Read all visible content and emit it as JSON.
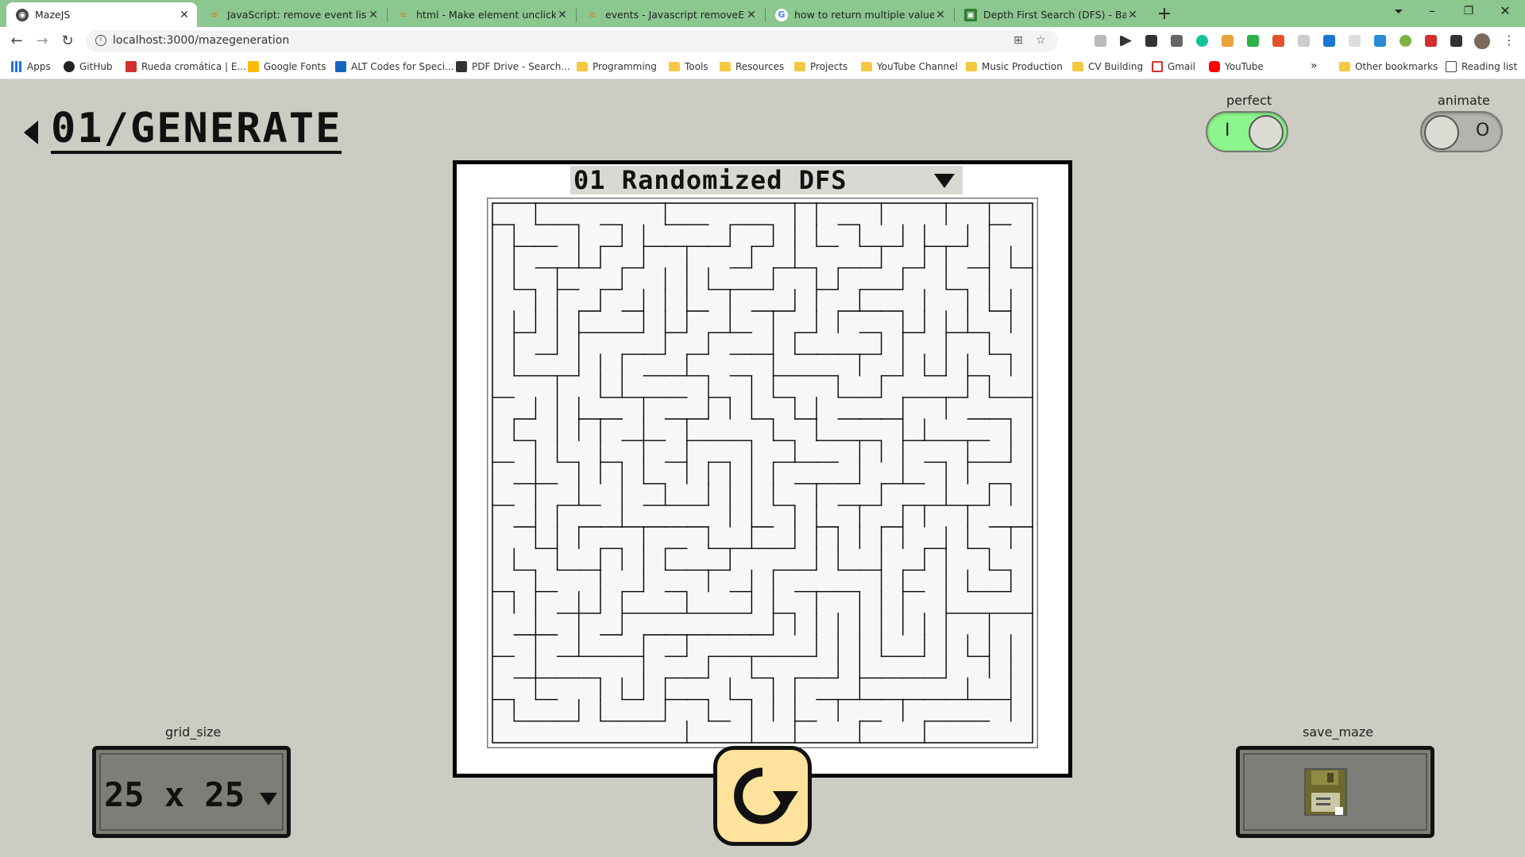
{
  "browser": {
    "tabs": [
      {
        "title": "MazeJS",
        "active": true
      },
      {
        "title": "JavaScript: remove event listener",
        "active": false
      },
      {
        "title": "html - Make element unclickable",
        "active": false
      },
      {
        "title": "events - Javascript removeEventL",
        "active": false
      },
      {
        "title": "how to return multiple values in",
        "active": false
      },
      {
        "title": "Depth First Search (DFS) - Backtr",
        "active": false
      }
    ],
    "url": "localhost:3000/mazegeneration",
    "bookmarks": [
      "Apps",
      "GitHub",
      "Rueda cromática | E...",
      "Google Fonts",
      "ALT Codes for Speci...",
      "PDF Drive - Search...",
      "Programming",
      "Tools",
      "Resources",
      "Projects",
      "YouTube Channel",
      "Music Production",
      "CV Building",
      "Gmail",
      "YouTube"
    ],
    "bookmarks_overflow": "»",
    "other_bookmarks": "Other bookmarks",
    "reading_list": "Reading list"
  },
  "page": {
    "title": "01/GENERATE",
    "perfect": {
      "label": "perfect",
      "state_text": "I",
      "on": true
    },
    "animate": {
      "label": "animate",
      "state_text": "O",
      "on": false
    },
    "algorithm": {
      "selected": "01 Randomized DFS"
    },
    "grid_size": {
      "label": "grid_size",
      "value": "25 x 25"
    },
    "save_maze": {
      "label": "save_maze"
    }
  },
  "colors": {
    "page_bg": "#ccccc2",
    "tabbar_bg": "#8bc78f",
    "toggle_on": "#8cf58c",
    "toggle_off": "#b4b4ae",
    "regenerate_bg": "#ffe29b",
    "button_bg": "#7e7e78"
  },
  "icons": {
    "back": "caret-left-icon",
    "regenerate": "refresh-icon",
    "save": "floppy-disk-icon"
  }
}
